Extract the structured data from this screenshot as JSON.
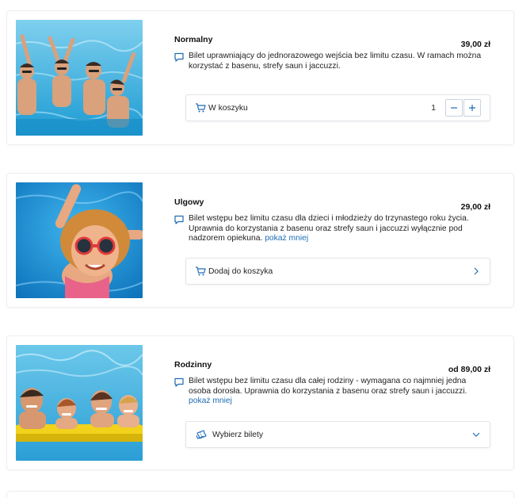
{
  "products": [
    {
      "title": "Normalny",
      "price": "39,00 zł",
      "description": "Bilet uprawniający do jednorazowego wejścia bez limitu czasu. W ramach można korzystać z basenu, strefy saun i jaccuzzi.",
      "show_less": "",
      "action_label": "W koszyku",
      "quantity": "1",
      "image_icon": "friends-in-pool-photo"
    },
    {
      "title": "Ulgowy",
      "price": "29,00 zł",
      "description": "Bilet wstępu bez limitu czasu dla dzieci i młodzieży do trzynastego roku życia. Uprawnia do korzystania z basenu oraz strefy saun i jaccuzzi wyłącznie pod nadzorem opiekuna.",
      "show_less": "pokaż mniej",
      "action_label": "Dodaj do koszyka",
      "image_icon": "child-swimming-photo"
    },
    {
      "title": "Rodzinny",
      "price": "od 89,00 zł",
      "description": "Bilet wstępu bez limitu czasu dla całej rodziny - wymagana co najmniej jedna osoba dorosła. Uprawnia do korzystania z basenu oraz strefy saun i jaccuzzi.",
      "show_less": "pokaż mniej",
      "action_label": "Wybierz bilety",
      "image_icon": "family-on-float-photo"
    }
  ],
  "colors": {
    "accent": "#1f6cb5",
    "border": "#e1e4e8",
    "water": "#29a3d9"
  }
}
